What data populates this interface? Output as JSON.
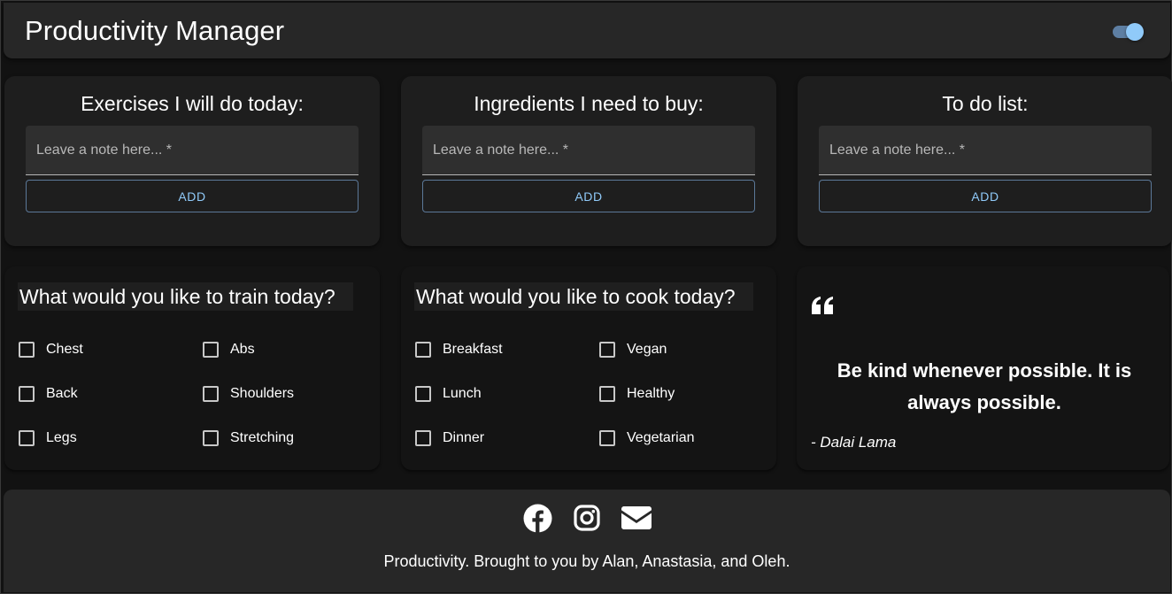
{
  "header": {
    "title": "Productivity Manager",
    "theme_toggle_on": true
  },
  "note_cards": [
    {
      "title": "Exercises I will do today:",
      "placeholder": "Leave a note here... *",
      "button": "ADD"
    },
    {
      "title": "Ingredients I need to buy:",
      "placeholder": "Leave a note here... *",
      "button": "ADD"
    },
    {
      "title": "To do list:",
      "placeholder": "Leave a note here... *",
      "button": "ADD"
    }
  ],
  "train": {
    "title": "What would you like to train today?",
    "options": [
      "Chest",
      "Abs",
      "Back",
      "Shoulders",
      "Legs",
      "Stretching"
    ]
  },
  "cook": {
    "title": "What would you like to cook today?",
    "options": [
      "Breakfast",
      "Vegan",
      "Lunch",
      "Healthy",
      "Dinner",
      "Vegetarian"
    ]
  },
  "quote": {
    "icon": "quote-left-icon",
    "text": "Be kind whenever possible. It is always possible.",
    "author": "- Dalai Lama"
  },
  "footer": {
    "icons": [
      "facebook-icon",
      "instagram-icon",
      "email-icon"
    ],
    "credit": "Productivity. Brought to you by Alan, Anastasia, and Oleh."
  },
  "colors": {
    "background": "#121212",
    "surface": "#1e1e1e",
    "appbar": "#272727",
    "accent": "#90caf9"
  }
}
